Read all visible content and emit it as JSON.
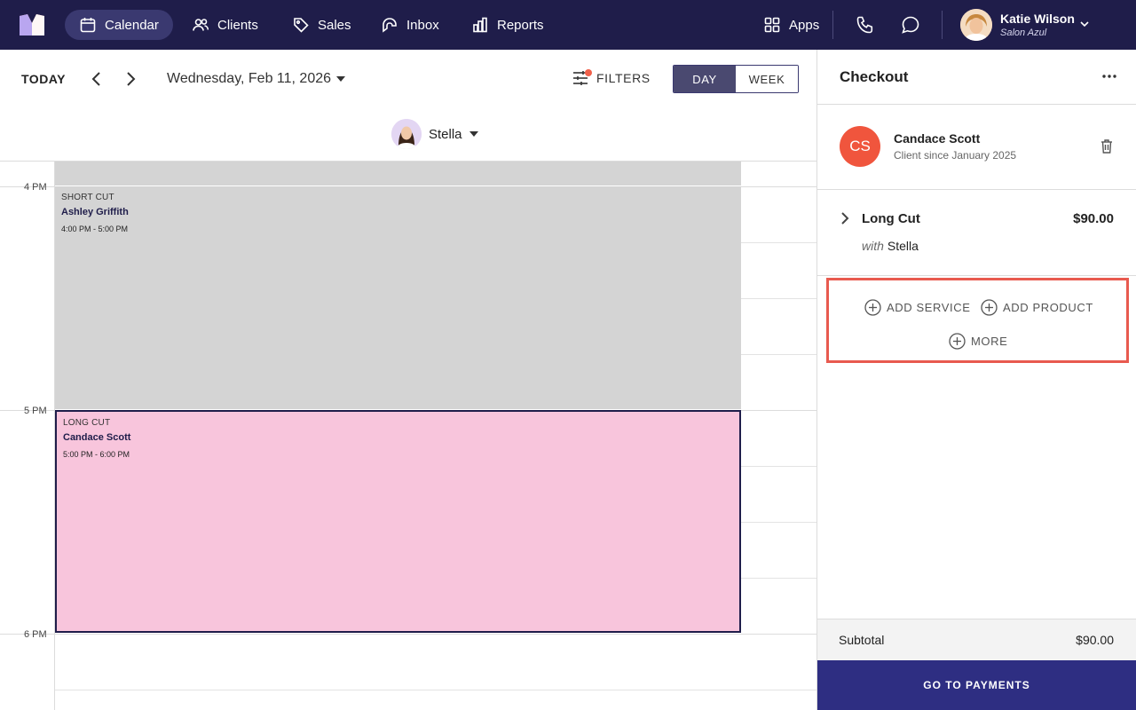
{
  "nav": {
    "items": [
      {
        "label": "Calendar",
        "icon": "calendar-icon",
        "active": true
      },
      {
        "label": "Clients",
        "icon": "users-icon"
      },
      {
        "label": "Sales",
        "icon": "tag-icon"
      },
      {
        "label": "Inbox",
        "icon": "inbox-icon"
      },
      {
        "label": "Reports",
        "icon": "bar-chart-icon"
      }
    ],
    "apps_label": "Apps",
    "user": {
      "name": "Katie Wilson",
      "salon": "Salon Azul"
    },
    "colors": {
      "background": "#1f1d4a",
      "active": "#3a3970"
    }
  },
  "calendar": {
    "today_label": "TODAY",
    "date": "Wednesday, Feb 11, 2026",
    "filters_label": "FILTERS",
    "views": {
      "day": "DAY",
      "week": "WEEK",
      "selected": "DAY"
    },
    "staff": "Stella",
    "time_labels": [
      "4 PM",
      "5 PM",
      "6 PM"
    ],
    "appointments": [
      {
        "service": "SHORT CUT",
        "client": "Ashley Griffith",
        "time": "4:00 PM - 5:00 PM",
        "color": "#d4d4d4"
      },
      {
        "service": "LONG CUT",
        "client": "Candace Scott",
        "time": "5:00 PM - 6:00 PM",
        "color": "#f8c5dc"
      }
    ]
  },
  "checkout": {
    "title": "Checkout",
    "client": {
      "initials": "CS",
      "name": "Candace Scott",
      "since": "Client since January 2025",
      "avatar_color": "#f0553d"
    },
    "service": {
      "name": "Long Cut",
      "price": "$90.00",
      "with_label": "with",
      "staff": "Stella"
    },
    "actions": {
      "add_service": "ADD SERVICE",
      "add_product": "ADD PRODUCT",
      "more": "MORE"
    },
    "subtotal_label": "Subtotal",
    "subtotal": "$90.00",
    "pay_label": "GO TO PAYMENTS"
  }
}
